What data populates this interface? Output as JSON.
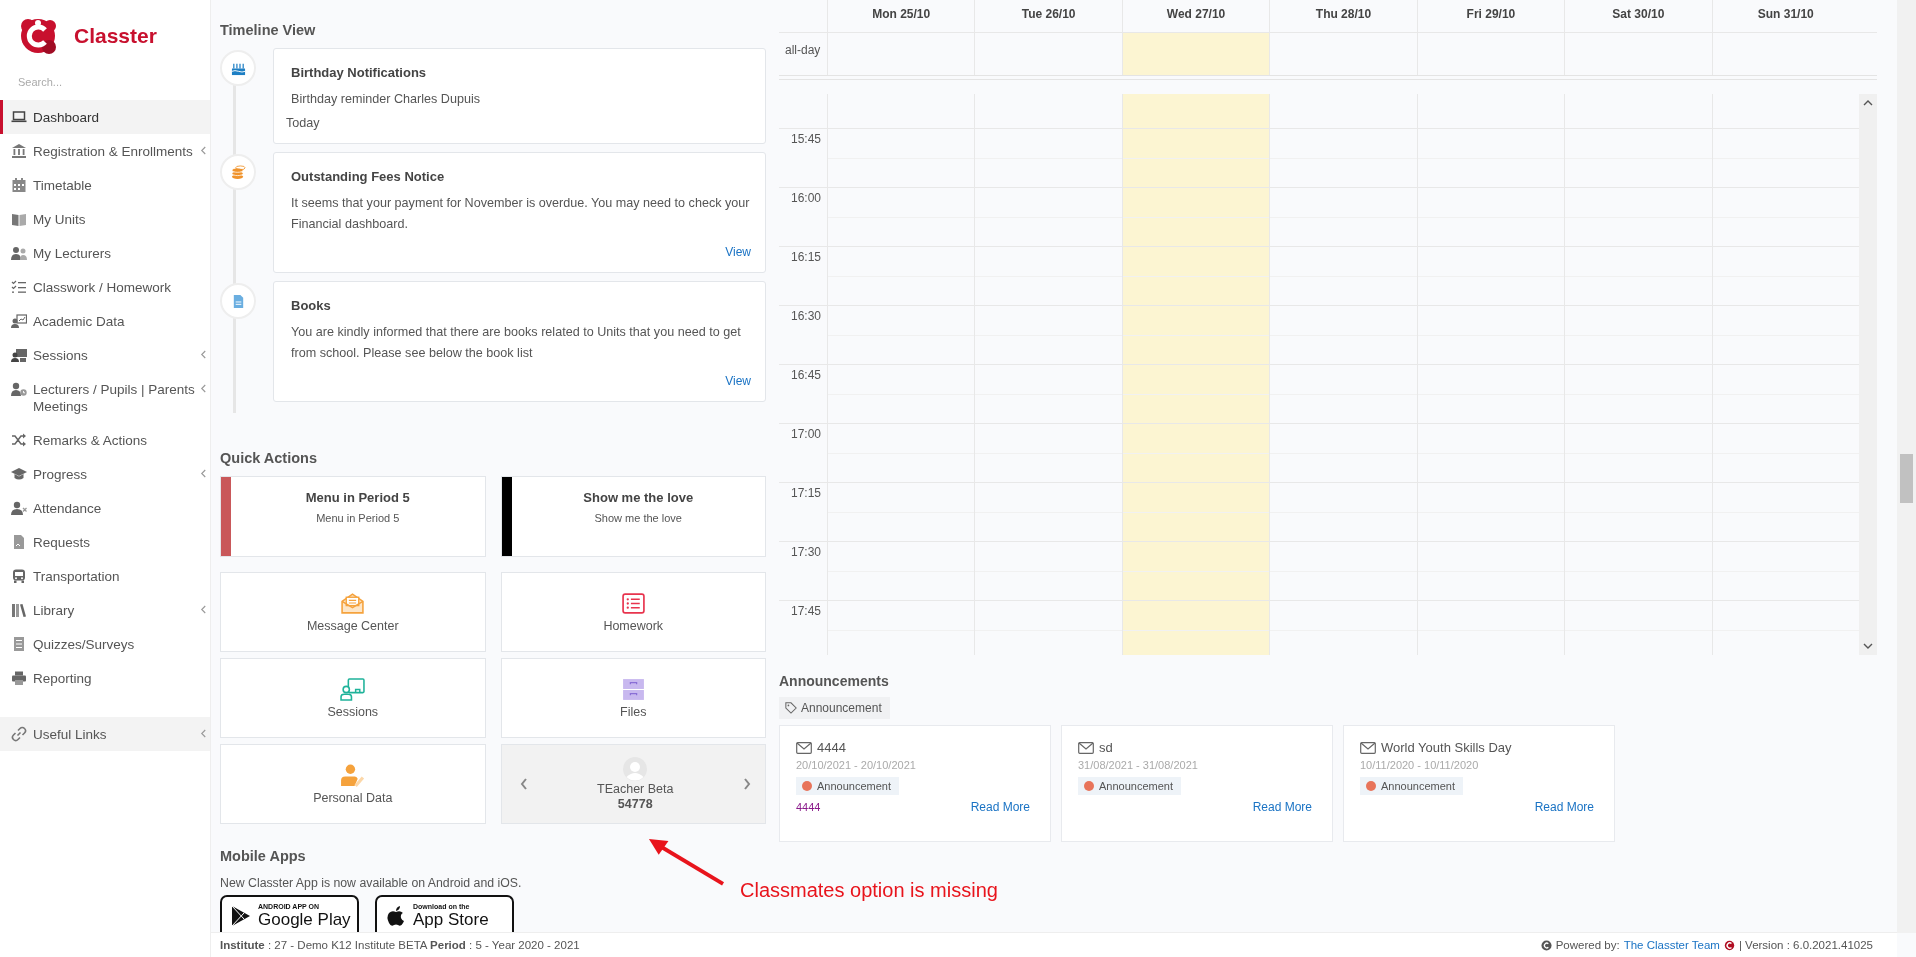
{
  "brand": {
    "name": "Classter"
  },
  "sidebar": {
    "search": {
      "placeholder": "Search..."
    },
    "items": [
      {
        "label": "Dashboard",
        "selected": true,
        "expandable": false
      },
      {
        "label": "Registration & Enrollments",
        "selected": false,
        "expandable": true
      },
      {
        "label": "Timetable",
        "selected": false,
        "expandable": false
      },
      {
        "label": "My Units",
        "selected": false,
        "expandable": false
      },
      {
        "label": "My Lecturers",
        "selected": false,
        "expandable": false
      },
      {
        "label": "Classwork / Homework",
        "selected": false,
        "expandable": false
      },
      {
        "label": "Academic Data",
        "selected": false,
        "expandable": false
      },
      {
        "label": "Sessions",
        "selected": false,
        "expandable": true
      },
      {
        "label": "Lecturers / Pupils | Parents Meetings",
        "selected": false,
        "expandable": true
      },
      {
        "label": "Remarks & Actions",
        "selected": false,
        "expandable": false
      },
      {
        "label": "Progress",
        "selected": false,
        "expandable": true
      },
      {
        "label": "Attendance",
        "selected": false,
        "expandable": false
      },
      {
        "label": "Requests",
        "selected": false,
        "expandable": false
      },
      {
        "label": "Transportation",
        "selected": false,
        "expandable": false
      },
      {
        "label": "Library",
        "selected": false,
        "expandable": true
      },
      {
        "label": "Quizzes/Surveys",
        "selected": false,
        "expandable": false
      },
      {
        "label": "Reporting",
        "selected": false,
        "expandable": false
      }
    ],
    "bottom_items": [
      {
        "label": "Useful Links",
        "selected": false,
        "expandable": true
      }
    ]
  },
  "timeline": {
    "title": "Timeline View",
    "entries": [
      {
        "kind": "birthday",
        "title": "Birthday Notifications",
        "text": "Birthday reminder Charles Dupuis",
        "when": "Today"
      },
      {
        "kind": "fees",
        "title": "Outstanding Fees Notice",
        "text": "It seems that your payment for November is overdue. You may need to check your Financial dashboard.",
        "link": "View"
      },
      {
        "kind": "books",
        "title": "Books",
        "text": "You are kindly informed that there are books related to Units that you need to get from school. Please see below the book list",
        "link": "View"
      }
    ]
  },
  "quick_actions": {
    "title": "Quick Actions",
    "banners": [
      {
        "title": "Menu in Period 5",
        "subtitle": "Menu in Period 5",
        "color": "#c9585a"
      },
      {
        "title": "Show me the love",
        "subtitle": "Show me the love",
        "color": "#000000"
      }
    ],
    "tiles": [
      {
        "kind": "message",
        "label": "Message Center"
      },
      {
        "kind": "homework",
        "label": "Homework"
      },
      {
        "kind": "sessions",
        "label": "Sessions"
      },
      {
        "kind": "files",
        "label": "Files"
      },
      {
        "kind": "personal",
        "label": "Personal Data"
      }
    ],
    "profile_card": {
      "name": "TEacher Beta",
      "code": "54778"
    }
  },
  "mobile_apps": {
    "title": "Mobile Apps",
    "text": "New Classter App is now available on Android and iOS.",
    "badges": [
      {
        "kind": "google",
        "small": "ANDROID APP ON",
        "big": "Google Play"
      },
      {
        "kind": "apple",
        "small": "Download on the",
        "big": "App Store"
      }
    ]
  },
  "calendar": {
    "all_day_label": "all-day",
    "days": [
      {
        "label": "Mon 25/10",
        "today": false
      },
      {
        "label": "Tue 26/10",
        "today": false
      },
      {
        "label": "Wed 27/10",
        "today": true
      },
      {
        "label": "Thu 28/10",
        "today": false
      },
      {
        "label": "Fri 29/10",
        "today": false
      },
      {
        "label": "Sat 30/10",
        "today": false
      },
      {
        "label": "Sun 31/10",
        "today": false
      }
    ],
    "times": [
      "15:45",
      "16:00",
      "16:15",
      "16:30",
      "16:45",
      "17:00",
      "17:15",
      "17:30",
      "17:45"
    ]
  },
  "announcements": {
    "title": "Announcements",
    "filter": "Announcement",
    "items": [
      {
        "title": "4444",
        "dates": "20/10/2021 - 20/10/2021",
        "tag": "Announcement",
        "color": "#e8745a",
        "excerpt": "4444",
        "link": "Read More"
      },
      {
        "title": "sd",
        "dates": "31/08/2021 - 31/08/2021",
        "tag": "Announcement",
        "color": "#e8745a",
        "link": "Read More"
      },
      {
        "title": "World Youth Skills Day",
        "dates": "10/11/2020 - 10/11/2020",
        "tag": "Announcement",
        "color": "#e8745a",
        "link": "Read More"
      }
    ]
  },
  "annotation": {
    "text": "Classmates option is missing"
  },
  "footer": {
    "info": "**Institute** : 27 - Demo K12 Institute BETA **Period** : 5 - Year 2020 - 2021",
    "powered": "Powered by:",
    "team": "The Classter Team",
    "version": "| Version : 6.0.2021.41025"
  }
}
